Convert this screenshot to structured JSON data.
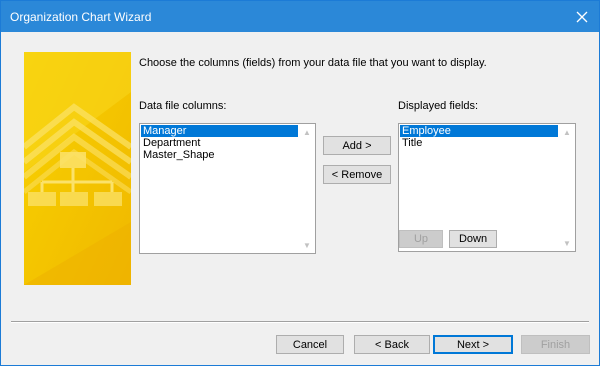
{
  "window": {
    "title": "Organization Chart Wizard",
    "close_icon": "close-icon"
  },
  "instruction": "Choose the columns (fields) from your data file that you want to display.",
  "data_columns": {
    "label": "Data file columns:",
    "items": [
      "Manager",
      "Department",
      "Master_Shape"
    ],
    "selected_index": 0
  },
  "displayed_fields": {
    "label": "Displayed fields:",
    "items": [
      "Employee",
      "Title"
    ],
    "selected_index": 0
  },
  "buttons": {
    "add": "Add >",
    "remove": "< Remove",
    "up": "Up",
    "down": "Down",
    "cancel": "Cancel",
    "back": "< Back",
    "next": "Next >",
    "finish": "Finish"
  },
  "colors": {
    "titlebar": "#2b88d8",
    "selection": "#0078d7",
    "art": "#f5c400"
  }
}
